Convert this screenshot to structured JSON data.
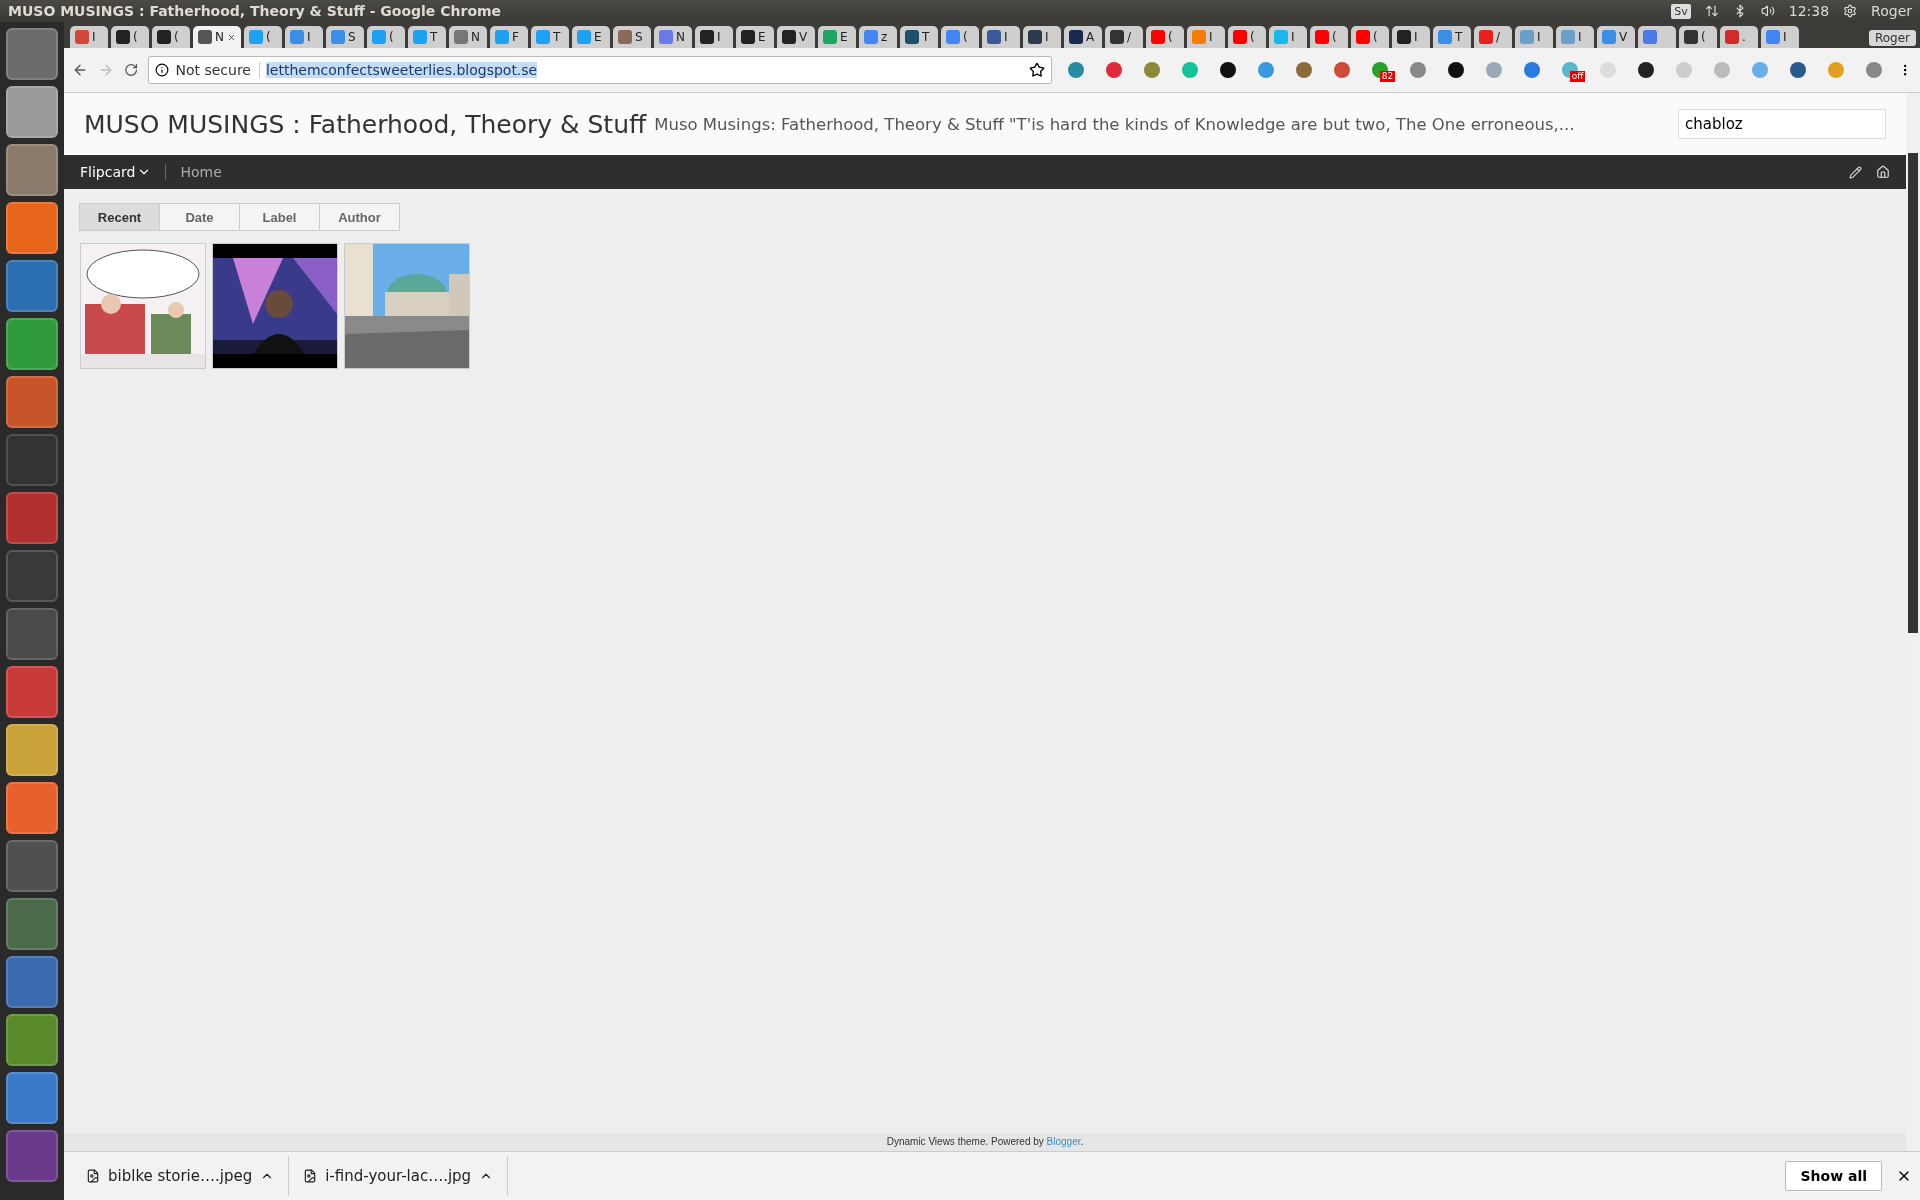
{
  "window": {
    "title": "MUSO MUSINGS : Fatherhood, Theory & Stuff - Google Chrome"
  },
  "system_tray": {
    "language": "Sv",
    "time": "12:38",
    "user": "Roger"
  },
  "launcher": [
    {
      "color": "#6b6b6b"
    },
    {
      "color": "#9a9a9a"
    },
    {
      "color": "#8a7a6a"
    },
    {
      "color": "#e8661c"
    },
    {
      "color": "#2a6fb0"
    },
    {
      "color": "#2e9a3a"
    },
    {
      "color": "#c8542a"
    },
    {
      "color": "#333333"
    },
    {
      "color": "#b03030"
    },
    {
      "color": "#3a3a3a"
    },
    {
      "color": "#4a4a4a"
    },
    {
      "color": "#c83a3a"
    },
    {
      "color": "#c9a23a"
    },
    {
      "color": "#e8602a"
    },
    {
      "color": "#505050"
    },
    {
      "color": "#4a6a4a"
    },
    {
      "color": "#3a6ab0"
    },
    {
      "color": "#5a8a2a"
    },
    {
      "color": "#3a7ac8"
    },
    {
      "color": "#6a3a8a"
    }
  ],
  "tabs": [
    {
      "label": "I",
      "color": "#d44638",
      "selected": false
    },
    {
      "label": "(",
      "color": "#222222",
      "selected": false
    },
    {
      "label": "(",
      "color": "#222222",
      "selected": false
    },
    {
      "label": "N",
      "color": "#555555",
      "selected": true
    },
    {
      "label": "(",
      "color": "#1da1f2",
      "selected": false
    },
    {
      "label": "I",
      "color": "#3a8ee6",
      "selected": false
    },
    {
      "label": "S",
      "color": "#3a8ee6",
      "selected": false
    },
    {
      "label": "(",
      "color": "#1da1f2",
      "selected": false
    },
    {
      "label": "T",
      "color": "#1da1f2",
      "selected": false
    },
    {
      "label": "N",
      "color": "#777777",
      "selected": false
    },
    {
      "label": "F",
      "color": "#1da1f2",
      "selected": false
    },
    {
      "label": "T",
      "color": "#1da1f2",
      "selected": false
    },
    {
      "label": "E",
      "color": "#1da1f2",
      "selected": false
    },
    {
      "label": "S",
      "color": "#8a6a5a",
      "selected": false
    },
    {
      "label": "N",
      "color": "#6a7ae8",
      "selected": false
    },
    {
      "label": "I",
      "color": "#222222",
      "selected": false
    },
    {
      "label": "E",
      "color": "#222222",
      "selected": false
    },
    {
      "label": "V",
      "color": "#222222",
      "selected": false
    },
    {
      "label": "E",
      "color": "#1fa463",
      "selected": false
    },
    {
      "label": "z",
      "color": "#4285f4",
      "selected": false
    },
    {
      "label": "T",
      "color": "#1f4f6a",
      "selected": false
    },
    {
      "label": "(",
      "color": "#4285f4",
      "selected": false
    },
    {
      "label": "I",
      "color": "#3b5998",
      "selected": false
    },
    {
      "label": "I",
      "color": "#2a3a4a",
      "selected": false
    },
    {
      "label": "A",
      "color": "#1a2a4a",
      "selected": false
    },
    {
      "label": "/",
      "color": "#333333",
      "selected": false
    },
    {
      "label": "(",
      "color": "#ff0000",
      "selected": false
    },
    {
      "label": "I",
      "color": "#f57d00",
      "selected": false
    },
    {
      "label": "(",
      "color": "#ff0000",
      "selected": false
    },
    {
      "label": "I",
      "color": "#1ab7ea",
      "selected": false
    },
    {
      "label": "(",
      "color": "#ff0000",
      "selected": false
    },
    {
      "label": "(",
      "color": "#ff0000",
      "selected": false
    },
    {
      "label": "I",
      "color": "#222222",
      "selected": false
    },
    {
      "label": "T",
      "color": "#3a8ee6",
      "selected": false
    },
    {
      "label": "/",
      "color": "#e8201a",
      "selected": false
    },
    {
      "label": "I",
      "color": "#6aa0c8",
      "selected": false
    },
    {
      "label": "I",
      "color": "#6aa0c8",
      "selected": false
    },
    {
      "label": "V",
      "color": "#3a8ee6",
      "selected": false
    },
    {
      "color": "#4a7ae8",
      "selected": false
    },
    {
      "label": "(",
      "color": "#333333",
      "selected": false
    },
    {
      "label": ".",
      "color": "#d42a2a",
      "selected": false
    },
    {
      "label": "I",
      "color": "#4285f4",
      "selected": false
    }
  ],
  "profile_button": "Roger",
  "address_bar": {
    "security": "Not secure",
    "url": "letthemconfectsweeterlies.blogspot.se"
  },
  "extensions": [
    {
      "color": "#2a8aa0"
    },
    {
      "color": "#e02a3a"
    },
    {
      "color": "#8a8a3a"
    },
    {
      "color": "#15c39a"
    },
    {
      "color": "#111111"
    },
    {
      "color": "#3a9ae0"
    },
    {
      "color": "#8a6a3a"
    },
    {
      "color": "#d04a3a"
    },
    {
      "color": "#2aa02a",
      "badge": "82"
    },
    {
      "color": "#888888"
    },
    {
      "color": "#111111"
    },
    {
      "color": "#9aa8b8"
    },
    {
      "color": "#2a7ae0"
    },
    {
      "color": "#5ab8c8",
      "badge": "off"
    },
    {
      "color": "#dddddd"
    },
    {
      "color": "#222222"
    },
    {
      "color": "#cccccc"
    },
    {
      "color": "#bbbbbb"
    },
    {
      "color": "#6aaee8"
    },
    {
      "color": "#2a5a8a"
    },
    {
      "color": "#e0a020"
    },
    {
      "color": "#888888"
    }
  ],
  "blog": {
    "title": "MUSO MUSINGS : Fatherhood, Theory & Stuff",
    "description": "Muso Musings: Fatherhood, Theory & Stuff \"T'is hard the kinds of Knowledge are but two, The One erroneous,...",
    "search": {
      "value": "chabloz"
    },
    "nav": {
      "menu": "Flipcard",
      "link": "Home"
    },
    "view_tabs": [
      {
        "label": "Recent",
        "selected": true
      },
      {
        "label": "Date",
        "selected": false
      },
      {
        "label": "Label",
        "selected": false
      },
      {
        "label": "Author",
        "selected": false
      }
    ],
    "footer": {
      "text": "Dynamic Views theme. Powered by ",
      "link": "Blogger",
      "end": "."
    }
  },
  "downloads": {
    "items": [
      "biblke storie….jpeg",
      "i-find-your-lac….jpg"
    ],
    "show_all": "Show all"
  }
}
